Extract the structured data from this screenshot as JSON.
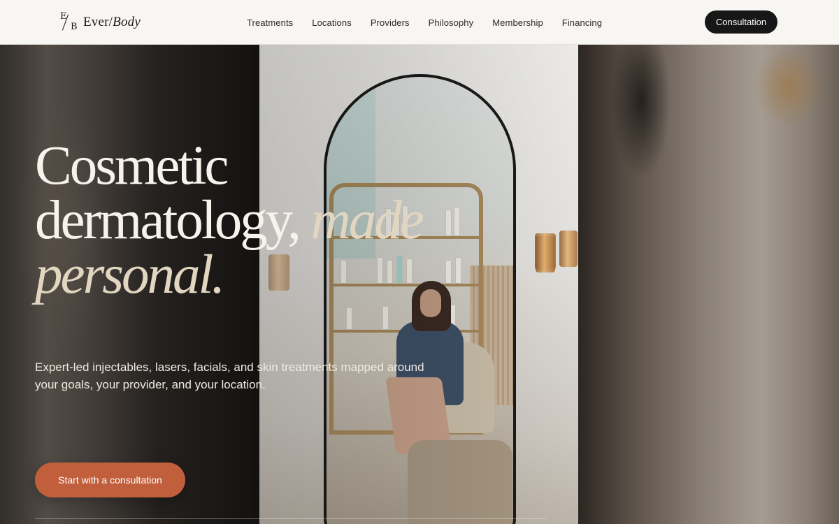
{
  "brand": {
    "mark_top": "E",
    "mark_bottom": "B",
    "name_first": "Ever",
    "name_sep": "/",
    "name_second": "Body"
  },
  "nav": {
    "items": [
      {
        "label": "Treatments"
      },
      {
        "label": "Locations"
      },
      {
        "label": "Providers"
      },
      {
        "label": "Philosophy"
      },
      {
        "label": "Membership"
      },
      {
        "label": "Financing"
      }
    ],
    "cta_label": "Consultation"
  },
  "hero": {
    "headline_line1": "Cosmetic",
    "headline_line2": "dermatology,",
    "headline_accent1": "made",
    "headline_accent2": "personal.",
    "subheading": "Expert-led injectables, lasers, facials, and skin treatments mapped around your goals, your provider, and your location.",
    "cta_label": "Start with a consultation"
  },
  "colors": {
    "header_bg": "#f8f6f3",
    "cta_dark": "#171717",
    "accent_terracotta": "#c15f3d",
    "headline_cream": "#f7f3ec",
    "headline_accent": "#e2d6c1"
  }
}
